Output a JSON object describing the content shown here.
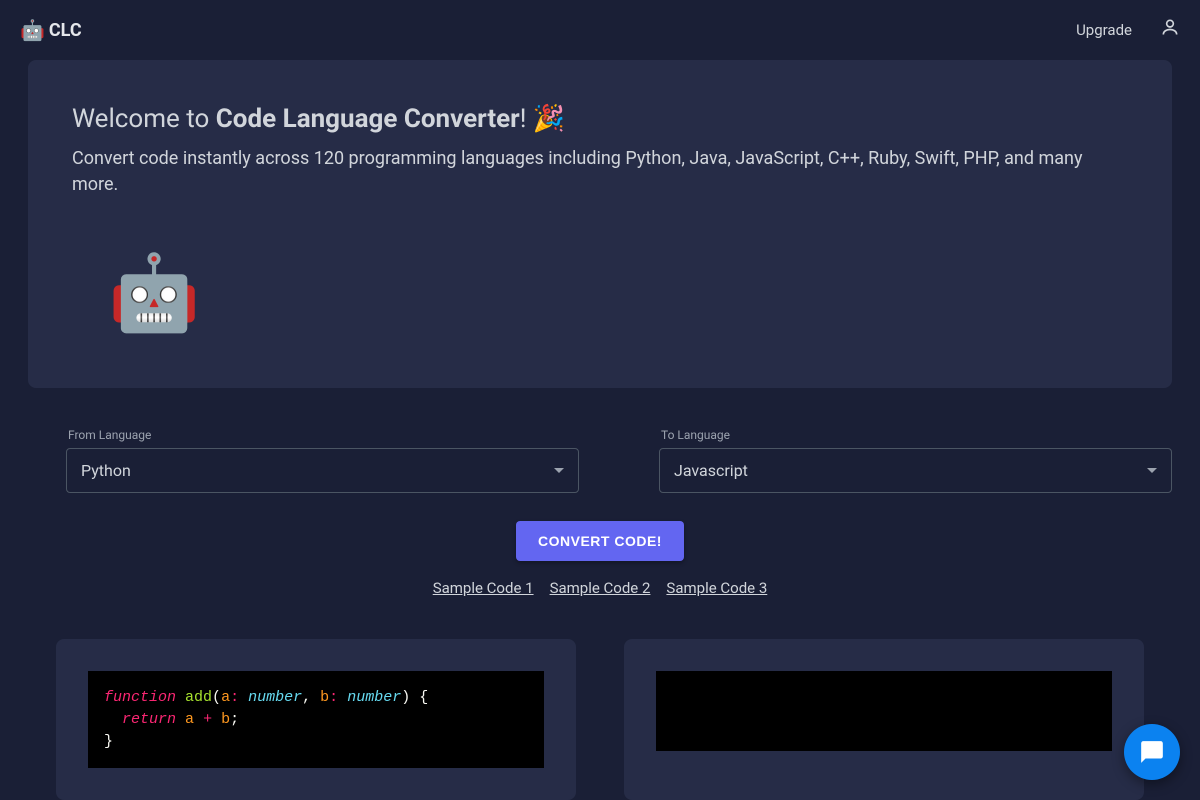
{
  "header": {
    "brand": "CLC",
    "brand_emoji": "🤖",
    "upgrade": "Upgrade"
  },
  "welcome": {
    "prefix": "Welcome to ",
    "title_strong": "Code Language Converter",
    "suffix": "! 🎉",
    "description": "Convert code instantly across 120 programming languages including Python, Java, JavaScript, C++, Ruby, Swift, PHP, and many more.",
    "robot": "🤖"
  },
  "from": {
    "label": "From Language",
    "value": "Python"
  },
  "to": {
    "label": "To Language",
    "value": "Javascript"
  },
  "convert_label": "CONVERT CODE!",
  "samples": [
    "Sample Code 1",
    "Sample Code 2",
    "Sample Code 3"
  ],
  "code_left": {
    "tok_function": "function",
    "tok_space": " ",
    "tok_add": "add",
    "tok_lparen": "(",
    "tok_a": "a",
    "tok_colon": ":",
    "tok_number": "number",
    "tok_comma": ", ",
    "tok_b": "b",
    "tok_rparen": ")",
    "tok_lbrace": " {",
    "tok_indent": "  ",
    "tok_return": "return",
    "tok_plus": " + ",
    "tok_semi": ";",
    "tok_rbrace": "}"
  }
}
